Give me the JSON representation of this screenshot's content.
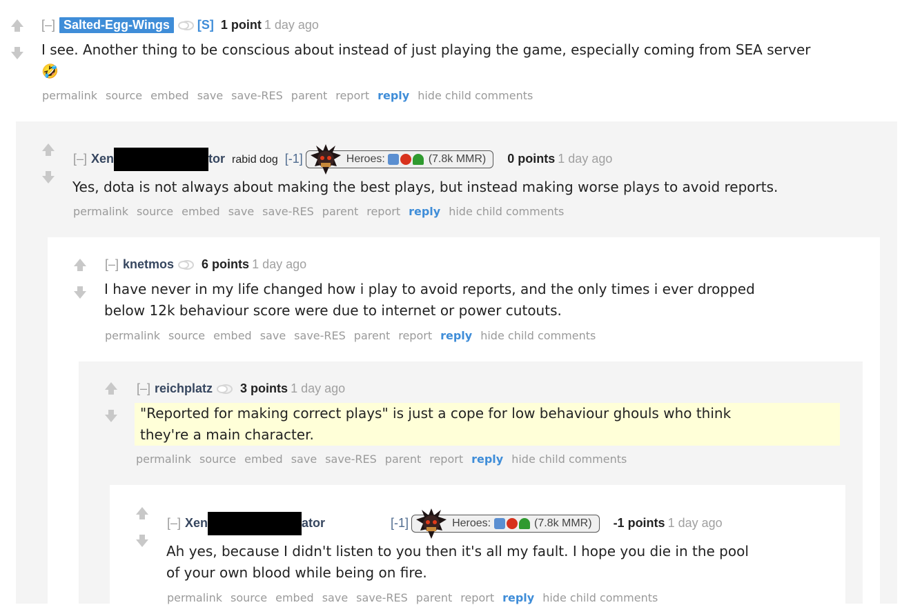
{
  "icons": {
    "upvote": "upvote-arrow-icon",
    "downvote": "downvote-arrow-icon",
    "friend": "friends-icon",
    "flair": "skull-flair-icon"
  },
  "colors": {
    "op_badge": "#3f8dd8",
    "reply": "#3f8dd8",
    "muted": "#9a9a9a",
    "highlight": "#ffffd8"
  },
  "buttons": {
    "permalink": "permalink",
    "source": "source",
    "embed": "embed",
    "save": "save",
    "save_res": "save-RES",
    "parent": "parent",
    "report": "report",
    "reply": "reply",
    "hide": "hide child comments"
  },
  "comments": [
    {
      "collapse": "[–]",
      "author": "Salted-Egg-Wings",
      "submitter": "[S]",
      "points": "1 point",
      "time": "1 day ago",
      "body_lines": [
        "I see. Another thing to be conscious about instead of just playing the game, especially coming from SEA server",
        "🤣"
      ]
    },
    {
      "collapse": "[–]",
      "author_prefix": "Xen",
      "author_suffix": "tor",
      "flair": "rabid dog",
      "karma": "[-1]",
      "heroes_label": "Heroes:",
      "mmr": "(7.8k MMR)",
      "points": "0 points",
      "time": "1 day ago",
      "body_lines": [
        "Yes, dota is not always about making the best plays, but instead making worse plays to avoid reports."
      ]
    },
    {
      "collapse": "[–]",
      "author": "knetmos",
      "points": "6 points",
      "time": "1 day ago",
      "body_lines": [
        "I have never in my life changed how i play to avoid reports, and the only times i ever dropped",
        "below 12k behaviour score were due to internet or power cutouts."
      ]
    },
    {
      "collapse": "[–]",
      "author": "reichplatz",
      "points": "3 points",
      "time": "1 day ago",
      "body_lines": [
        "\"Reported for making correct plays\" is just a cope for low behaviour ghouls who think",
        "they're a main character."
      ]
    },
    {
      "collapse": "[–]",
      "author_prefix": "Xen",
      "author_suffix": "ator",
      "karma": "[-1]",
      "heroes_label": "Heroes:",
      "mmr": "(7.8k MMR)",
      "points": "-1 points",
      "time": "1 day ago",
      "body_lines": [
        "Ah yes, because I didn't listen to you then it's all my fault. I hope you die in the pool",
        "of your own blood while being on fire."
      ]
    }
  ]
}
